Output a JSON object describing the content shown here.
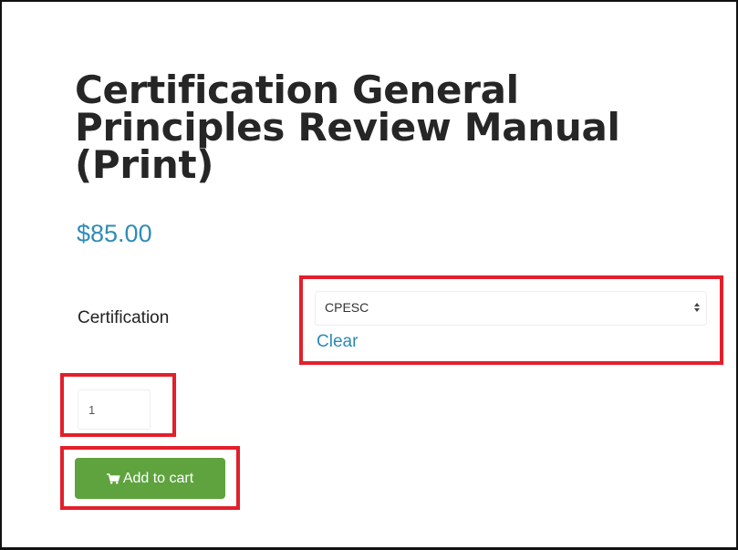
{
  "product": {
    "title": "Certification General Principles Review Manual (Print)",
    "price": "$85.00"
  },
  "variation": {
    "label": "Certification",
    "selected_value": "CPESC",
    "clear_label": "Clear"
  },
  "quantity": {
    "value": "1"
  },
  "cart": {
    "button_label": "Add to cart",
    "icon": "shopping-cart-icon"
  },
  "colors": {
    "price": "#2e8cb8",
    "link": "#2a8ab5",
    "button": "#5ea33e",
    "highlight": "#e21f2b"
  }
}
